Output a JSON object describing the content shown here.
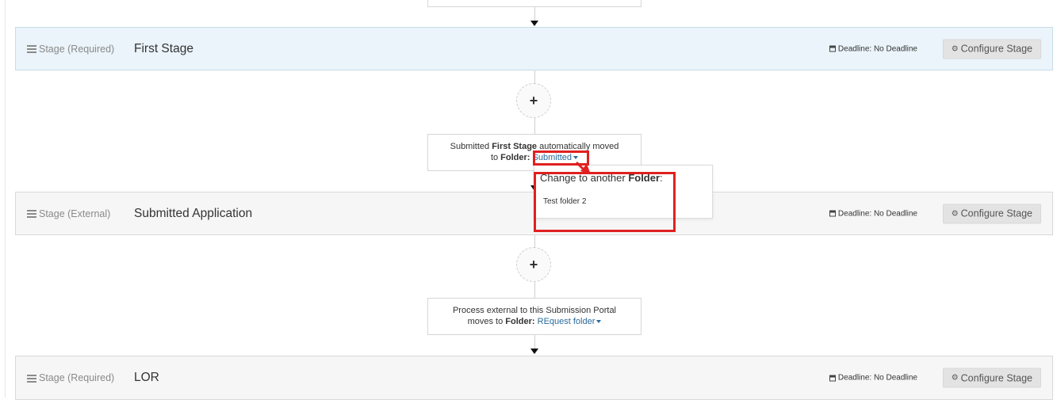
{
  "stages": [
    {
      "type": "Stage (Required)",
      "name": "First Stage",
      "deadline": "Deadline: No Deadline",
      "configure": "Configure Stage"
    },
    {
      "type": "Stage (External)",
      "name": "Submitted Application",
      "deadline": "Deadline: No Deadline",
      "configure": "Configure Stage"
    },
    {
      "type": "Stage (Required)",
      "name": "LOR",
      "deadline": "Deadline: No Deadline",
      "configure": "Configure Stage"
    }
  ],
  "add_stage_label": "+",
  "transitions": [
    {
      "line1_pre": "Submitted ",
      "line1_bold": "First Stage",
      "line1_post": " automatically moved",
      "line2_pre": "to ",
      "folder_label": "Folder:",
      "folder_value": "Submitted"
    },
    {
      "line1_pre": "Process external to this Submission Portal",
      "line2_pre": "moves to ",
      "folder_label": "Folder:",
      "folder_value": "REquest folder"
    }
  ],
  "folder_dropdown": {
    "header_pre": "Change to another ",
    "header_bold": "Folder",
    "header_post": ":",
    "options": [
      "Test folder 2"
    ]
  },
  "colors": {
    "highlight": "#e02020",
    "active_stage_bg": "#eaf4fa",
    "link": "#2a6a9a"
  }
}
